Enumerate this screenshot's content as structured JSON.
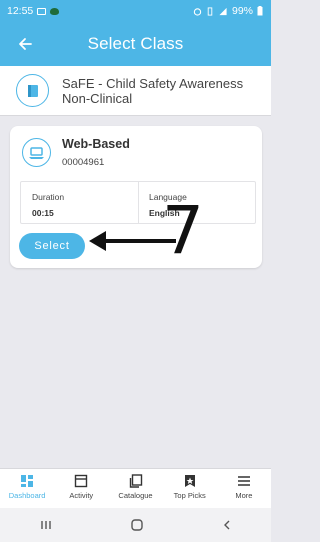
{
  "status_bar": {
    "time": "12:55",
    "battery": "99%"
  },
  "app_bar": {
    "title": "Select Class",
    "back_icon": "arrow-left-icon"
  },
  "course": {
    "title": "SaFE - Child Safety Awareness Non-Clinical",
    "icon": "book-icon"
  },
  "class_card": {
    "type": "Web-Based",
    "type_icon": "laptop-icon",
    "class_id": "00004961",
    "duration_label": "Duration",
    "duration_value": "00:15",
    "language_label": "Language",
    "language_value": "English",
    "select_label": "Select"
  },
  "annotation": {
    "number": "7"
  },
  "bottom_nav": {
    "items": [
      {
        "label": "Dashboard",
        "icon": "dashboard-icon",
        "active": true
      },
      {
        "label": "Activity",
        "icon": "activity-icon",
        "active": false
      },
      {
        "label": "Catalogue",
        "icon": "catalogue-icon",
        "active": false
      },
      {
        "label": "Top Picks",
        "icon": "top-picks-icon",
        "active": false
      },
      {
        "label": "More",
        "icon": "menu-icon",
        "active": false
      }
    ]
  },
  "colors": {
    "accent": "#4db6e6",
    "background": "#e9e9ee"
  }
}
